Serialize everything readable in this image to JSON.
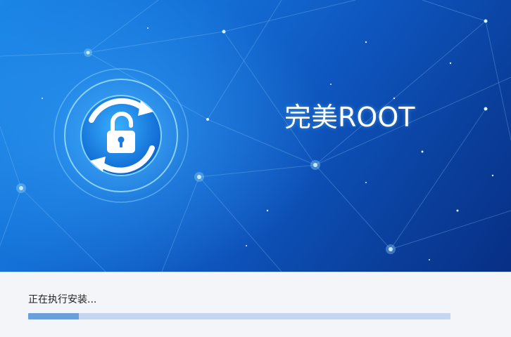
{
  "app": {
    "title": "完美ROOT"
  },
  "install": {
    "status_text": "正在执行安装...",
    "progress": 0.12
  },
  "logo": {
    "icon": "unlock-padlock-refresh-icon"
  },
  "colors": {
    "background_accent": "#1470d6",
    "progress_fill": "#6a9fdc",
    "progress_track": "#c6d6ee",
    "footer_bg": "#f3f5f9"
  }
}
